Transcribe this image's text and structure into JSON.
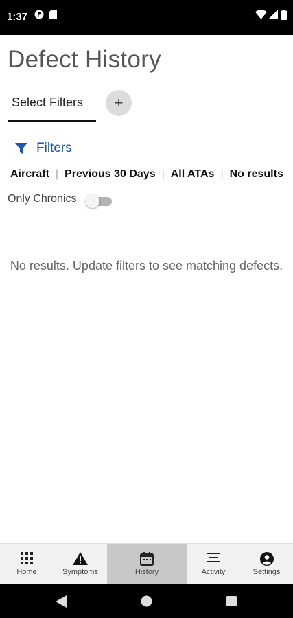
{
  "status": {
    "time": "1:37"
  },
  "page": {
    "title": "Defect History"
  },
  "tabs": {
    "select_label": "Select Filters",
    "add_label": "+"
  },
  "filters": {
    "link_label": "Filters",
    "summary": [
      "Aircraft",
      "Previous 30 Days",
      "All ATAs",
      "No results"
    ],
    "chronics_label": "Only Chronics",
    "chronics_on": false
  },
  "empty_message": "No results. Update filters to see matching defects.",
  "bottom_nav": {
    "items": [
      {
        "label": "Home",
        "icon": "grid-icon"
      },
      {
        "label": "Symptoms",
        "icon": "warning-icon"
      },
      {
        "label": "History",
        "icon": "calendar-icon",
        "active": true
      },
      {
        "label": "Activity",
        "icon": "list-icon"
      },
      {
        "label": "Settings",
        "icon": "account-circle-icon"
      }
    ]
  },
  "colors": {
    "accent": "#1a56b0",
    "active_nav": "#c8c8c8"
  }
}
